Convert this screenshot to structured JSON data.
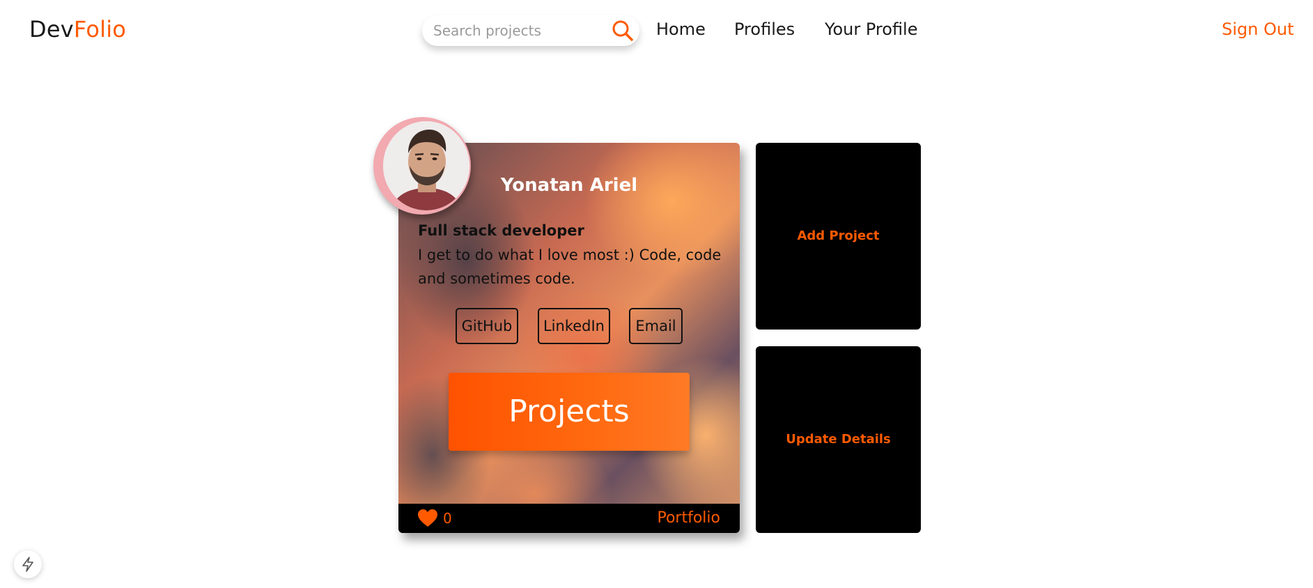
{
  "app": {
    "logo_part1": "Dev",
    "logo_part2": "Folio",
    "accent_color": "#ff5a00"
  },
  "header": {
    "search": {
      "placeholder": "Search projects",
      "value": "",
      "icon": "search-icon"
    },
    "nav": {
      "home": "Home",
      "profiles": "Profiles",
      "your_profile": "Your Profile"
    },
    "sign_out": "Sign Out"
  },
  "profile": {
    "name": "Yonatan Ariel",
    "title": "Full stack developer",
    "bio": "I get to do what I love most :) Code, code and sometimes code.",
    "links": {
      "github": "GitHub",
      "linkedin": "LinkedIn",
      "email": "Email"
    },
    "projects_button": "Projects",
    "likes": "0",
    "like_icon": "heart-icon",
    "portfolio": "Portfolio"
  },
  "actions": {
    "add_project": "Add Project",
    "update_details": "Update Details"
  },
  "widget": {
    "icon": "bolt-icon"
  }
}
